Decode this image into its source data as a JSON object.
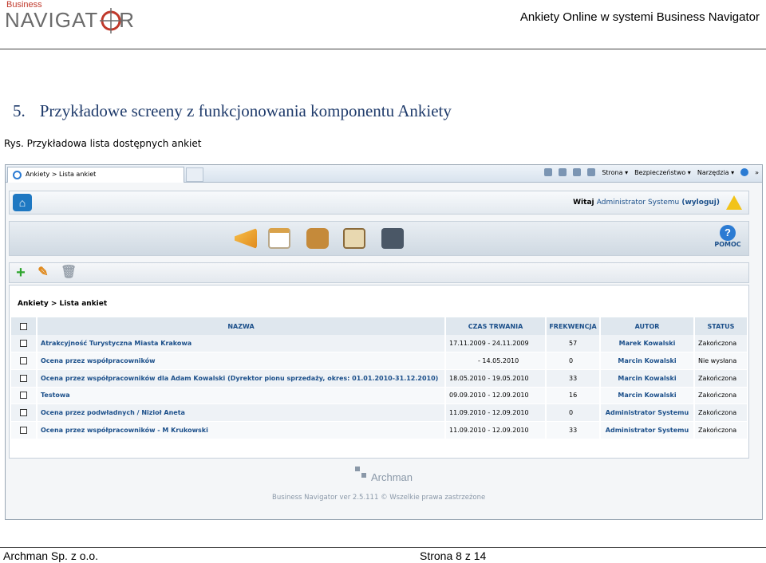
{
  "header": {
    "logo_small": "Business",
    "logo_big": "NAVIGAT",
    "logo_suffix": "R",
    "title": "Ankiety Online w systemi Business Navigator"
  },
  "section": {
    "number": "5.",
    "title": "Przykładowe screeny z funkcjonowania komponentu Ankiety"
  },
  "caption": "Rys. Przykładowa lista dostępnych ankiet",
  "browser": {
    "tab_title": "Ankiety > Lista ankiet",
    "tools": [
      "Strona ▾",
      "Bezpieczeństwo ▾",
      "Narzędzia ▾"
    ]
  },
  "app": {
    "welcome_prefix": "Witaj",
    "welcome_user": "Administrator Systemu",
    "logout": "(wyloguj)",
    "help_label": "POMOC",
    "breadcrumb": "Ankiety > Lista ankiet",
    "columns": [
      "NAZWA",
      "CZAS TRWANIA",
      "FREKWENCJA",
      "AUTOR",
      "STATUS"
    ],
    "rows": [
      {
        "name": "Atrakcyjność Turystyczna Miasta Krakowa",
        "duration": "17.11.2009 - 24.11.2009",
        "freq": "57",
        "author": "Marek Kowalski",
        "status": "Zakończona"
      },
      {
        "name": "Ocena przez współpracowników",
        "duration": "- 14.05.2010",
        "freq": "0",
        "author": "Marcin Kowalski",
        "status": "Nie wysłana"
      },
      {
        "name": "Ocena przez współpracowników dla Adam Kowalski (Dyrektor pionu sprzedaży, okres: 01.01.2010-31.12.2010)",
        "duration": "18.05.2010 - 19.05.2010",
        "freq": "33",
        "author": "Marcin Kowalski",
        "status": "Zakończona"
      },
      {
        "name": "Testowa",
        "duration": "09.09.2010 - 12.09.2010",
        "freq": "16",
        "author": "Marcin Kowalski",
        "status": "Zakończona"
      },
      {
        "name": "Ocena przez podwładnych / Nizioł Aneta",
        "duration": "11.09.2010 - 12.09.2010",
        "freq": "0",
        "author": "Administrator Systemu",
        "status": "Zakończona"
      },
      {
        "name": "Ocena przez współpracowników - M Krukowski",
        "duration": "11.09.2010 - 12.09.2010",
        "freq": "33",
        "author": "Administrator Systemu",
        "status": "Zakończona"
      }
    ],
    "footer_logo": "Archman",
    "footer_copy": "Business Navigator ver 2.5.111 © Wszelkie prawa zastrzeżone"
  },
  "footer": {
    "company": "Archman Sp. z o.o.",
    "page": "Strona 8 z 14"
  }
}
